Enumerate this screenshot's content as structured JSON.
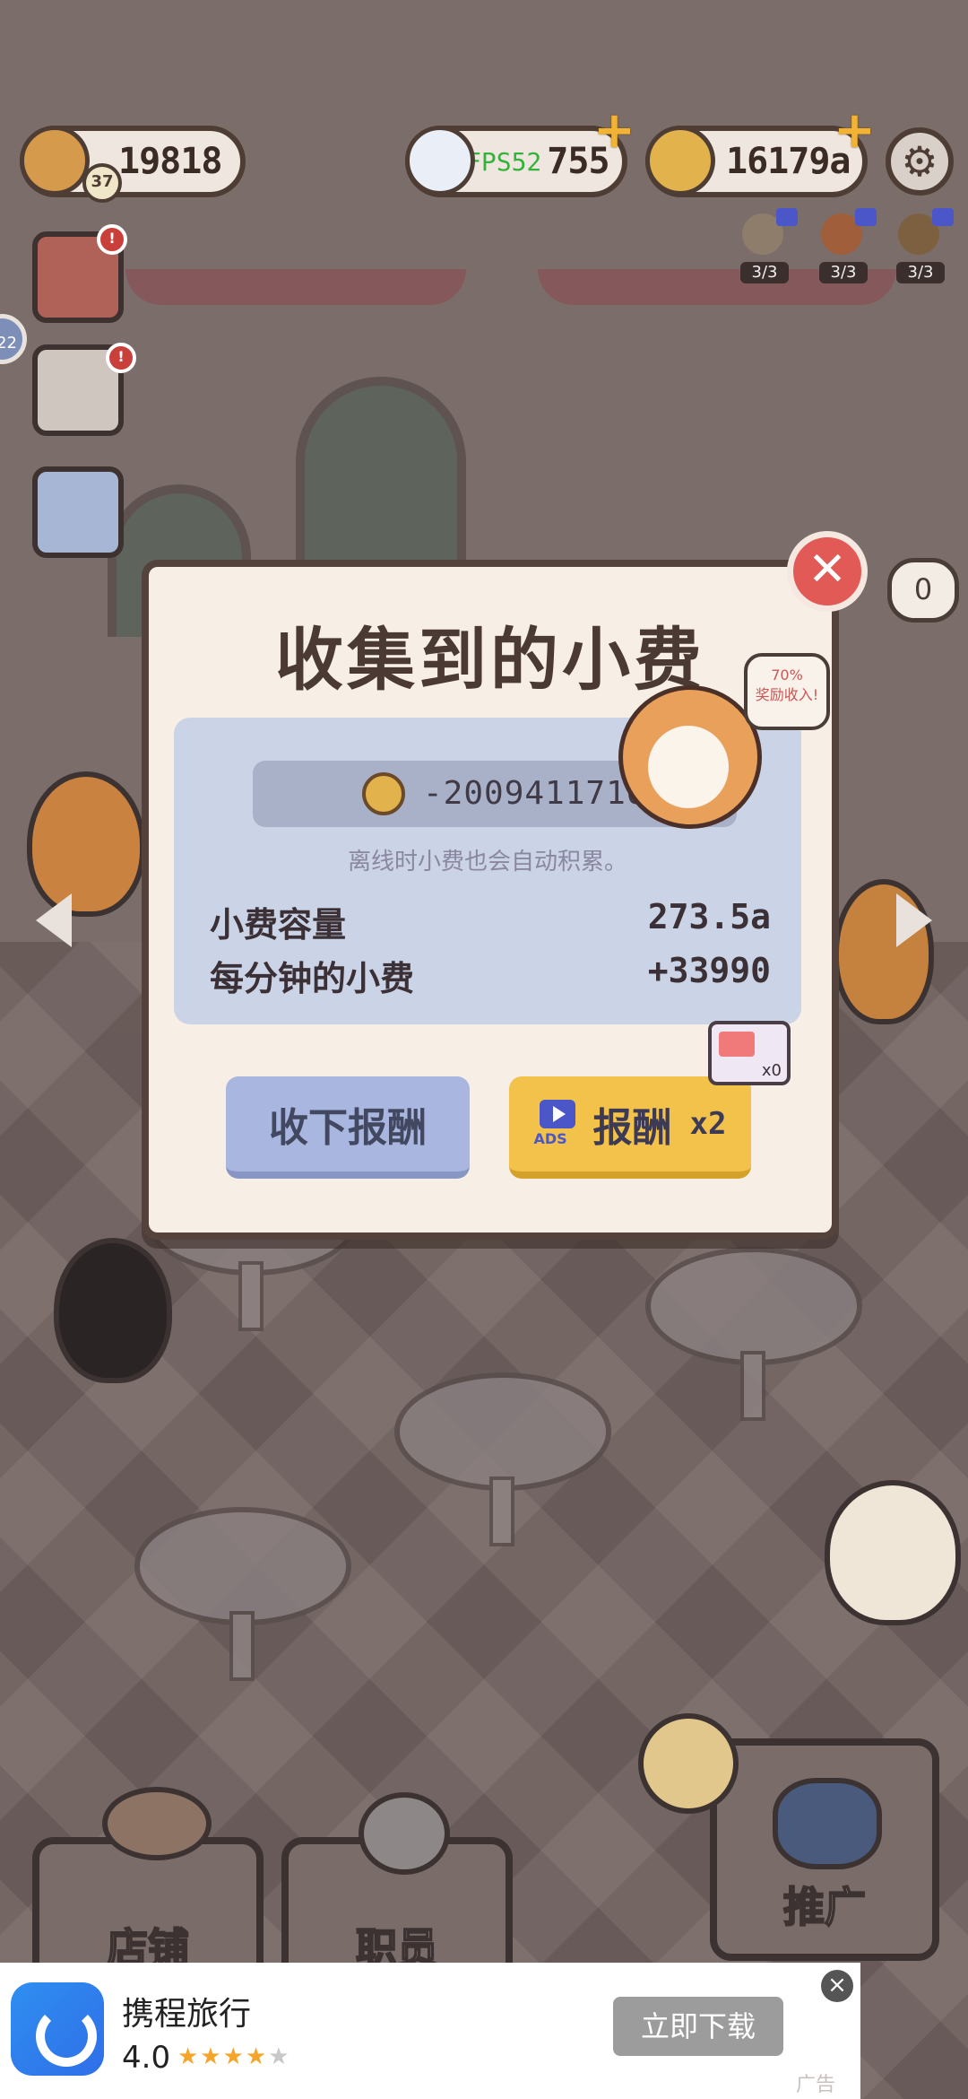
{
  "hud": {
    "bread": {
      "value": "19818",
      "level": "37",
      "icon": "bread-icon"
    },
    "diamond": {
      "value": "755",
      "fps_overlay": "FPS52",
      "icon": "diamond-icon"
    },
    "coins": {
      "value": "16179a",
      "icon": "coin-icon"
    },
    "boosters": [
      "3/3",
      "3/3",
      "3/3"
    ],
    "side_badge": "22",
    "speech_counter": "0"
  },
  "dialog": {
    "title": "收集到的小费",
    "amount": "-2009411716",
    "hint": "离线时小费也会自动积累。",
    "capacity_label": "小费容量",
    "capacity_value": "273.5a",
    "per_minute_label": "每分钟的小费",
    "per_minute_value": "+33990",
    "collect_button": "收下报酬",
    "ads_label": "ADS",
    "ads_button": "报酬",
    "multiplier": "x2",
    "ticket_count": "x0",
    "bubble_text": "70%\n奖励收入!"
  },
  "bottom_nav": {
    "shop": "店铺",
    "staff": "职员",
    "promote": "推广"
  },
  "ad": {
    "app_name": "携程旅行",
    "rating": "4.0",
    "stars_filled": 4,
    "stars_total": 5,
    "download": "立即下载",
    "close": "×",
    "tag": "广告"
  },
  "colors": {
    "dialog_bg": "#f7efe6",
    "panel_bg": "#cbd3e6",
    "collect_btn": "#a9b7e0",
    "ads_btn": "#f2c24a",
    "close_btn": "#e25a55",
    "download_btn": "#9c9c9c"
  }
}
